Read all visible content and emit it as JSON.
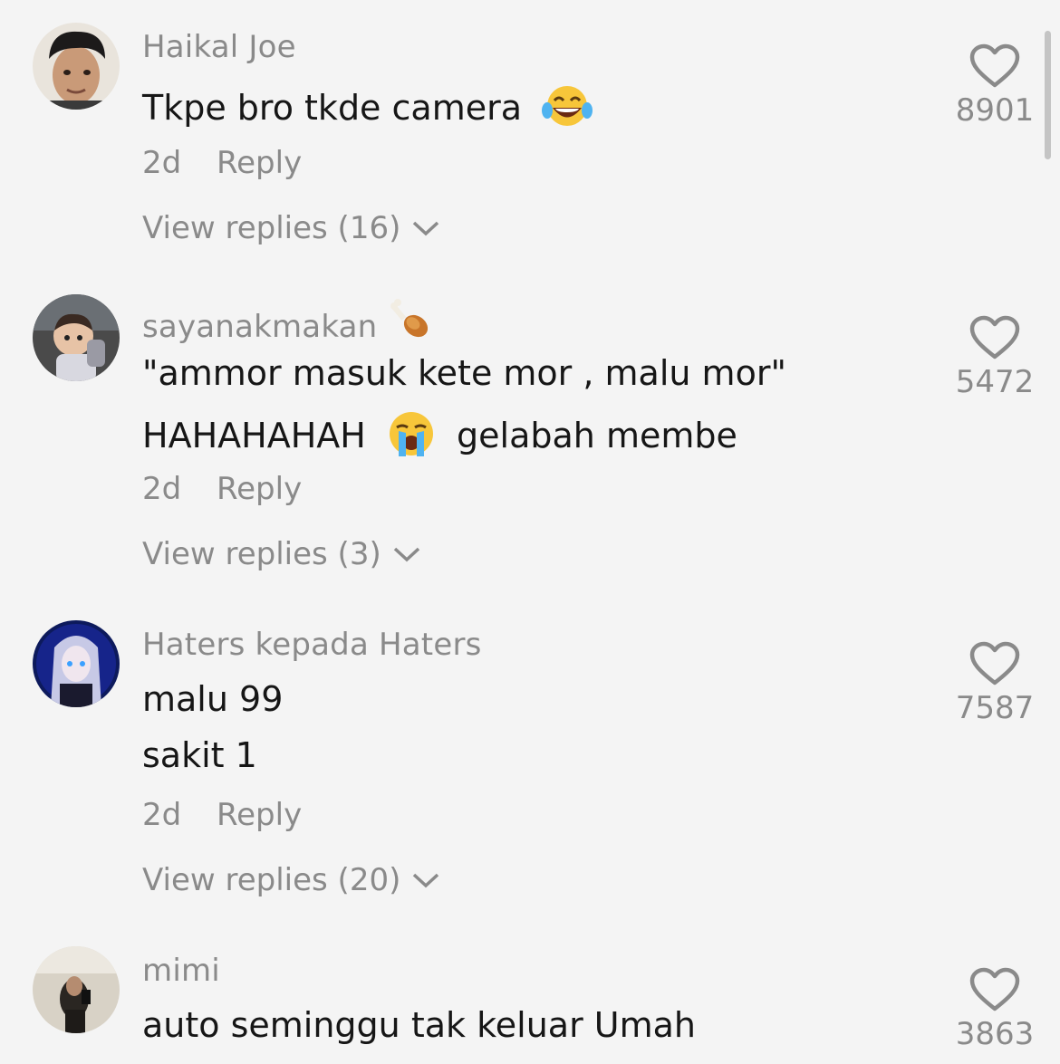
{
  "comments": [
    {
      "username": "Haikal Joe",
      "lines": [
        "Tkpe bro tkde camera"
      ],
      "time": "2d",
      "reply_label": "Reply",
      "view_replies": "View replies (16)",
      "likes": "8901",
      "line_emoji": "laughing-tears-emoji"
    },
    {
      "username": "sayanakmakan",
      "username_emoji": "drumstick-emoji",
      "lines": [
        "\"ammor masuk kete mor , malu mor\"",
        "HAHAHAHAH",
        "gelabah membe"
      ],
      "time": "2d",
      "reply_label": "Reply",
      "view_replies": "View replies (3)",
      "likes": "5472",
      "line_emoji": "crying-emoji"
    },
    {
      "username": "Haters kepada Haters",
      "lines": [
        "malu 99",
        "sakit 1"
      ],
      "time": "2d",
      "reply_label": "Reply",
      "view_replies": "View replies (20)",
      "likes": "7587"
    },
    {
      "username": "mimi",
      "lines": [
        "auto seminggu tak keluar Umah"
      ],
      "likes": "3863"
    }
  ],
  "colors": {
    "background": "#f4f4f4",
    "text": "#161616",
    "secondary": "#8a8a8a"
  }
}
